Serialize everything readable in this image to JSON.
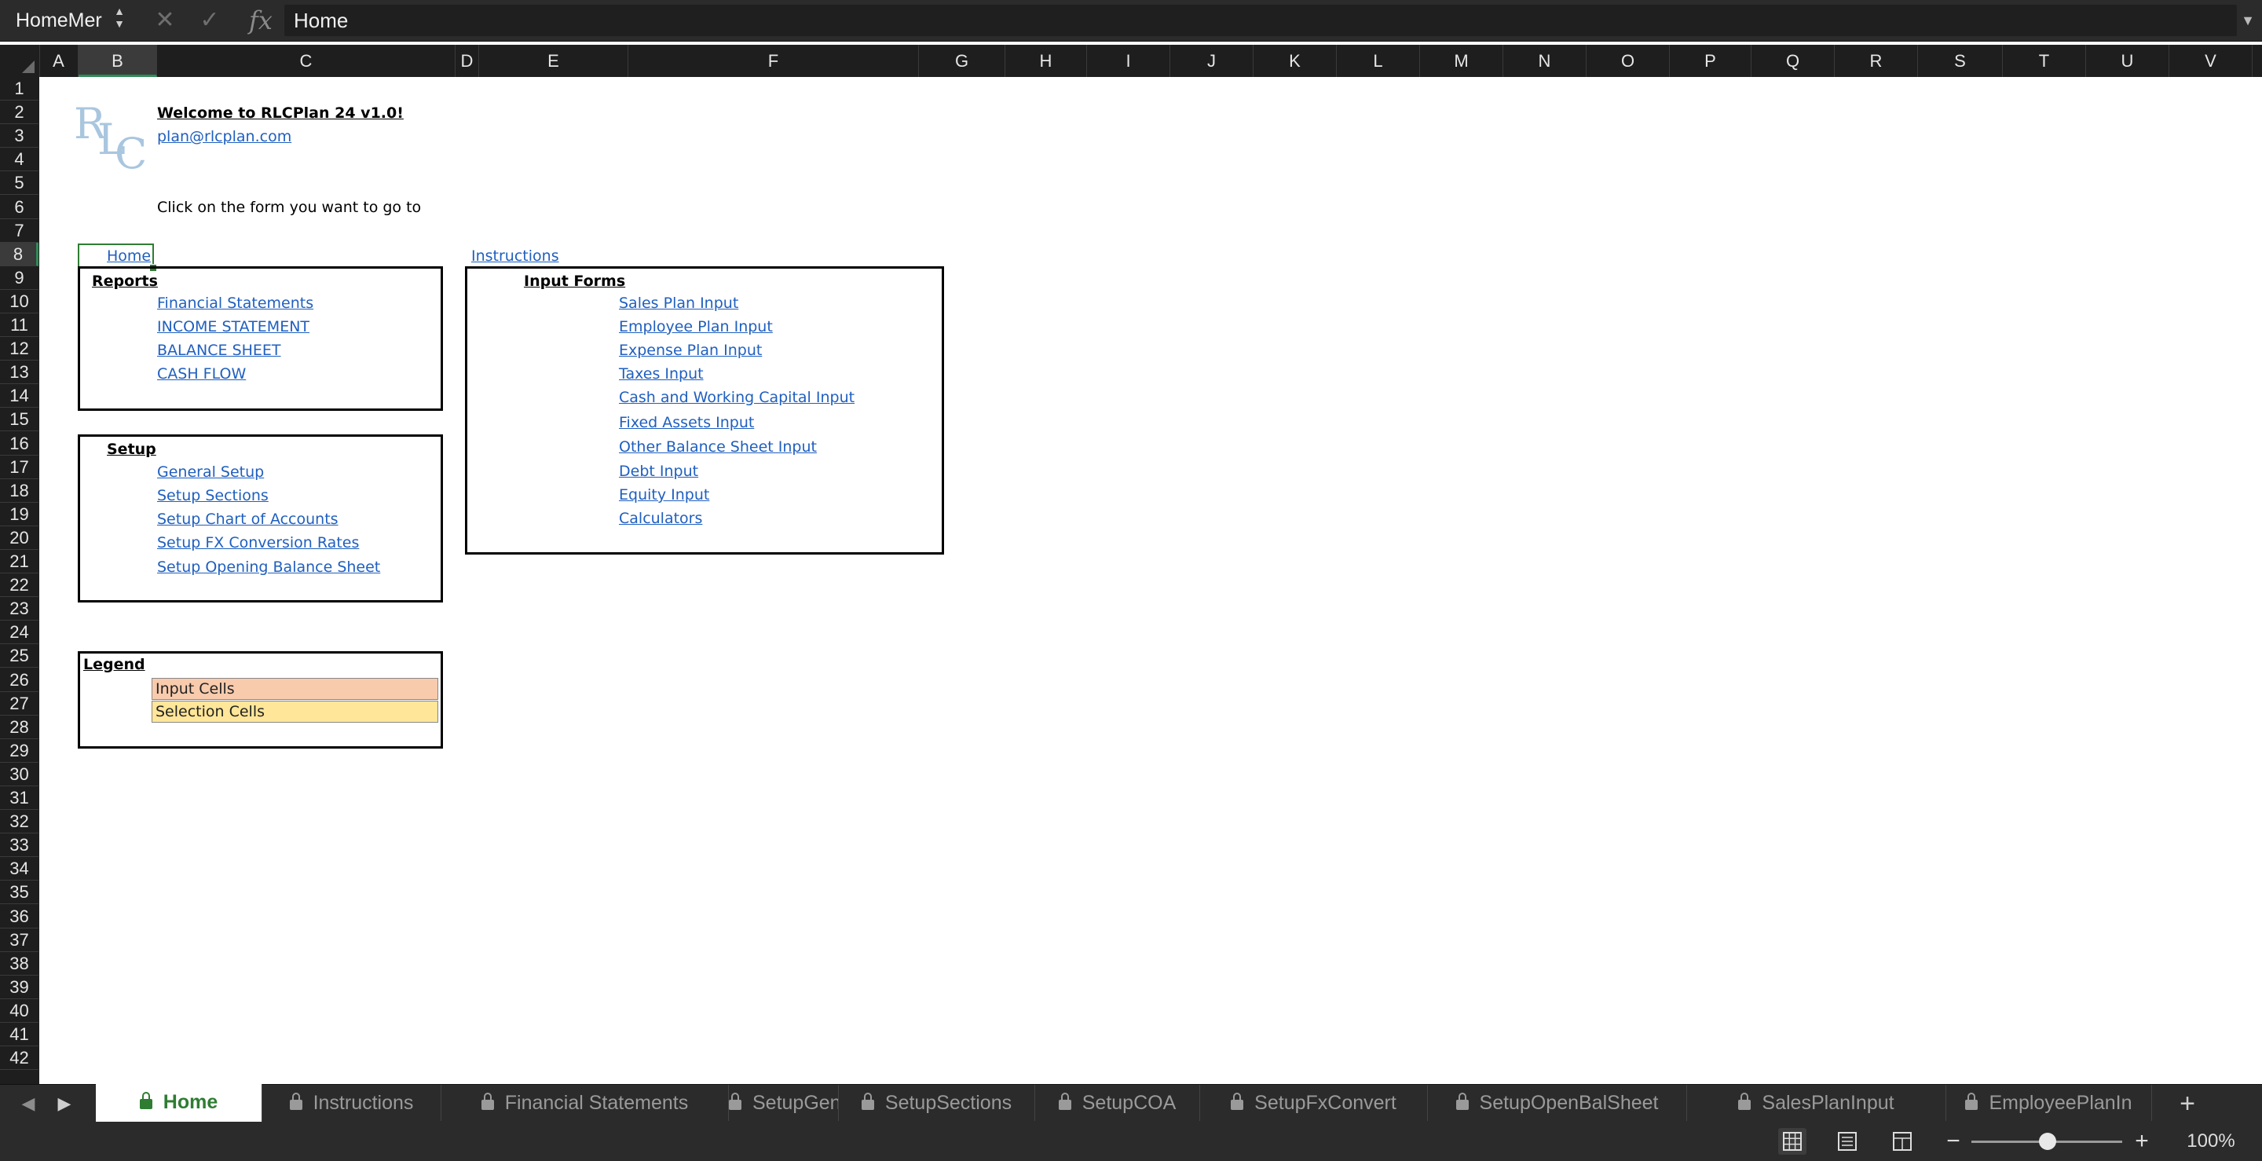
{
  "formula_bar": {
    "name_box": "HomeMer",
    "fx_label": "fx",
    "formula_value": "Home"
  },
  "columns": [
    "A",
    "B",
    "C",
    "D",
    "E",
    "F",
    "G",
    "H",
    "I",
    "J",
    "K",
    "L",
    "M",
    "N",
    "O",
    "P",
    "Q",
    "R",
    "S",
    "T",
    "U",
    "V"
  ],
  "selected_column": "B",
  "rows": [
    "1",
    "2",
    "3",
    "4",
    "5",
    "6",
    "7",
    "8",
    "9",
    "10",
    "11",
    "12",
    "13",
    "14",
    "15",
    "16",
    "17",
    "18",
    "19",
    "20",
    "21",
    "22",
    "23",
    "24",
    "25",
    "26",
    "27",
    "28",
    "29",
    "30",
    "31",
    "32",
    "33",
    "34",
    "35",
    "36",
    "37",
    "38",
    "39",
    "40",
    "41",
    "42"
  ],
  "selected_row": "8",
  "sheet": {
    "logo_letters": [
      "R",
      "L",
      "C"
    ],
    "welcome_title": "Welcome to RLCPlan 24 v1.0!",
    "email_link": "plan@rlcplan.com",
    "instruction_text": "Click on the form you want to go to",
    "home_link": "Home",
    "instructions_link": "Instructions",
    "reports": {
      "heading": "Reports",
      "links": [
        "Financial Statements",
        "INCOME STATEMENT",
        "BALANCE SHEET",
        "CASH FLOW"
      ]
    },
    "setup": {
      "heading": "Setup",
      "links": [
        "General Setup",
        "Setup Sections",
        "Setup Chart of Accounts",
        "Setup FX Conversion Rates",
        "Setup Opening Balance Sheet"
      ]
    },
    "input_forms": {
      "heading": "Input Forms",
      "links": [
        "Sales Plan Input",
        "Employee Plan Input",
        "Expense Plan Input",
        "Taxes Input",
        "Cash and Working Capital Input",
        "Fixed Assets Input",
        "Other Balance Sheet Input",
        "Debt Input",
        "Equity Input",
        "Calculators"
      ]
    },
    "legend": {
      "heading": "Legend",
      "items": [
        {
          "label": "Input Cells",
          "color": "#f8cbad"
        },
        {
          "label": "Selection Cells",
          "color": "#ffe699"
        }
      ]
    }
  },
  "sheet_tabs": [
    "Home",
    "Instructions",
    "Financial Statements",
    "SetupGeneral",
    "SetupSections",
    "SetupCOA",
    "SetupFxConvert",
    "SetupOpenBalSheet",
    "SalesPlanInput",
    "EmployeePlanIn"
  ],
  "active_tab": "Home",
  "status_bar": {
    "zoom_level": "100%"
  },
  "colors": {
    "accent": "#2e7d32",
    "link": "#1f5fbf",
    "chrome_dark": "#2b2b2b"
  }
}
